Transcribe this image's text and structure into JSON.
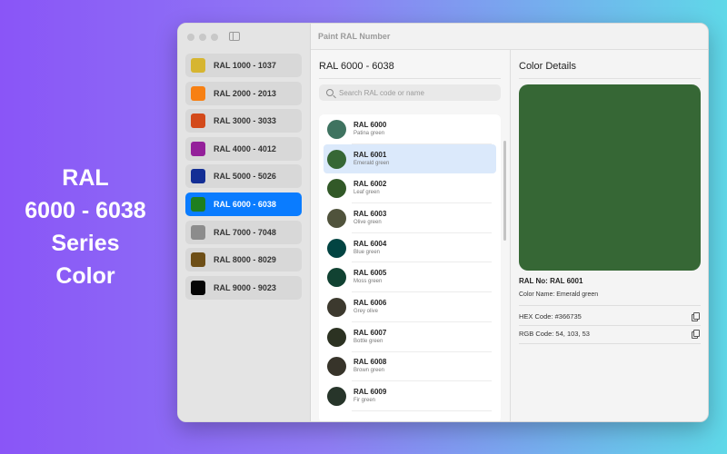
{
  "promo": {
    "lines": [
      "RAL",
      "6000 - 6038",
      "Series",
      "Color"
    ]
  },
  "toolbar": {
    "title": "Paint RAL Number"
  },
  "sidebar": {
    "items": [
      {
        "label": "RAL 1000 - 1037",
        "color": "#d6b531"
      },
      {
        "label": "RAL 2000 - 2013",
        "color": "#f78013"
      },
      {
        "label": "RAL 3000 - 3033",
        "color": "#d34a1b"
      },
      {
        "label": "RAL 4000 - 4012",
        "color": "#94209a"
      },
      {
        "label": "RAL 5000 - 5026",
        "color": "#132e95"
      },
      {
        "label": "RAL 6000 - 6038",
        "color": "#1f7f1f",
        "active": true
      },
      {
        "label": "RAL 7000 - 7048",
        "color": "#8c8c8c"
      },
      {
        "label": "RAL 8000 - 8029",
        "color": "#6e4f17"
      },
      {
        "label": "RAL 9000 - 9023",
        "color": "#050505"
      }
    ]
  },
  "list": {
    "title": "RAL 6000 - 6038",
    "search_placeholder": "Search RAL code or name",
    "items": [
      {
        "code": "RAL 6000",
        "name": "Patina green",
        "color": "#3f7360"
      },
      {
        "code": "RAL 6001",
        "name": "Emerald green",
        "color": "#366735",
        "selected": true
      },
      {
        "code": "RAL 6002",
        "name": "Leaf green",
        "color": "#325928"
      },
      {
        "code": "RAL 6003",
        "name": "Olive green",
        "color": "#50533c"
      },
      {
        "code": "RAL 6004",
        "name": "Blue green",
        "color": "#024442"
      },
      {
        "code": "RAL 6005",
        "name": "Moss green",
        "color": "#114232"
      },
      {
        "code": "RAL 6006",
        "name": "Grey olive",
        "color": "#3c392e"
      },
      {
        "code": "RAL 6007",
        "name": "Bottle green",
        "color": "#2c3222"
      },
      {
        "code": "RAL 6008",
        "name": "Brown green",
        "color": "#37342a"
      },
      {
        "code": "RAL 6009",
        "name": "Fir green",
        "color": "#27352a"
      }
    ]
  },
  "details": {
    "title": "Color Details",
    "preview_color": "#366735",
    "ral_no": "RAL No: RAL 6001",
    "color_name": "Color Name: Emerald green",
    "hex": "HEX Code: #366735",
    "rgb": "RGB Code: 54, 103, 53"
  }
}
